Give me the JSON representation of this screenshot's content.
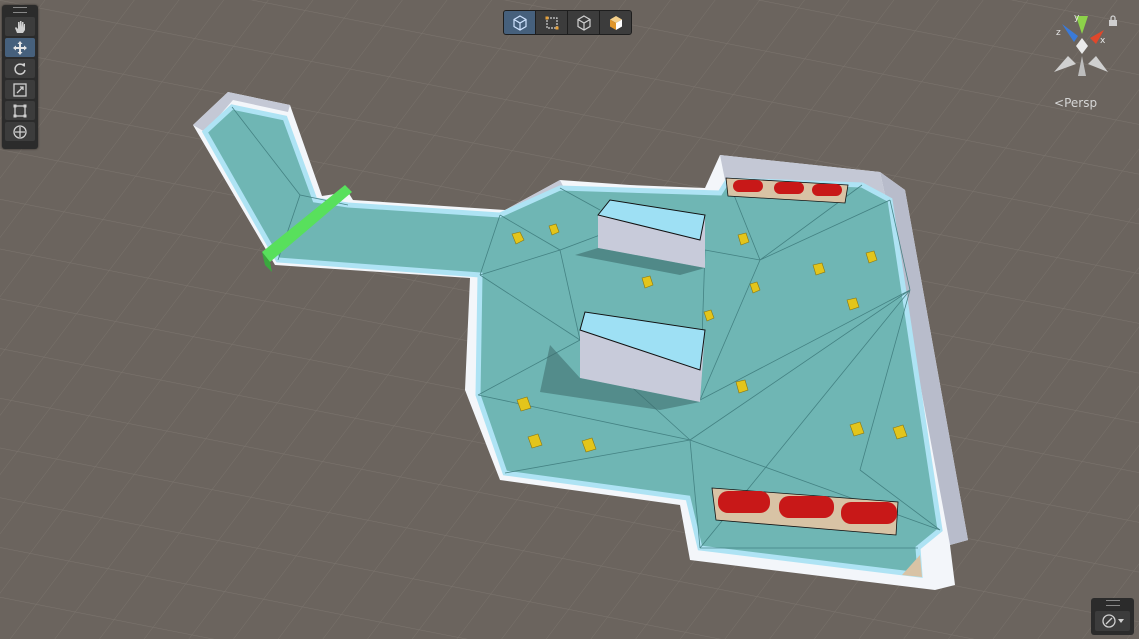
{
  "toolbar": {
    "tools": [
      {
        "name": "hand-tool",
        "icon": "hand-icon",
        "active": false
      },
      {
        "name": "move-tool",
        "icon": "move-arrows-icon",
        "active": true
      },
      {
        "name": "rotate-tool",
        "icon": "rotate-icon",
        "active": false
      },
      {
        "name": "scale-tool",
        "icon": "scale-icon",
        "active": false
      },
      {
        "name": "rect-tool",
        "icon": "rect-transform-icon",
        "active": false
      },
      {
        "name": "transform-tool",
        "icon": "transform-icon",
        "active": false
      }
    ]
  },
  "view_options": {
    "buttons": [
      {
        "name": "navmesh-view-button",
        "icon": "cube-wire-icon",
        "active": true
      },
      {
        "name": "rect-view-button",
        "icon": "rect-icon",
        "active": false
      },
      {
        "name": "mesh-view-button",
        "icon": "cube-outline-icon",
        "active": false
      },
      {
        "name": "shaded-view-button",
        "icon": "cube-orange-icon",
        "active": false
      }
    ]
  },
  "scene_gizmo": {
    "projection_label": "Persp",
    "axis_labels": {
      "x": "x",
      "y": "y",
      "z": "z"
    },
    "colors": {
      "x": "#e0472b",
      "y": "#8dd24a",
      "z": "#3a7ad9"
    }
  },
  "colors": {
    "background": "#6b645e",
    "grid": "#7a736c",
    "navmesh": "#6fb6b4",
    "wall": "#c6c9d6",
    "selected": "#58e05c",
    "enemy": "#e3c51b",
    "barrel": "#c81818"
  }
}
